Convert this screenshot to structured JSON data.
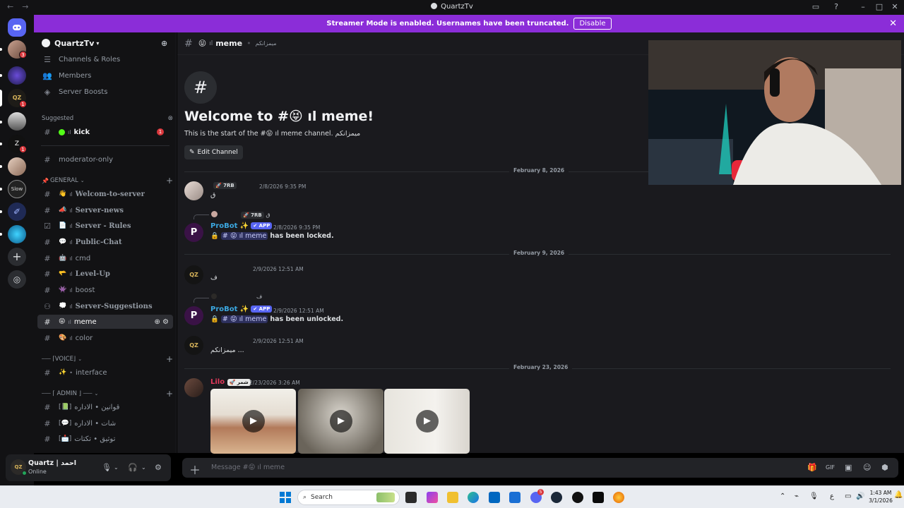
{
  "window": {
    "title": "QuartzTv",
    "back": "←",
    "forward": "→"
  },
  "banner": {
    "text": "Streamer Mode is enabled. Usernames have been truncated.",
    "button": "Disable"
  },
  "rail": {
    "badges": [
      "3",
      "1",
      "1"
    ]
  },
  "server": {
    "name": "QuartzTv"
  },
  "sidebar": {
    "top_items": [
      "Channels & Roles",
      "Members",
      "Server Boosts"
    ],
    "suggested_label": "Suggested",
    "suggested_channel": "kick",
    "suggested_badge": "1",
    "moderator": "moderator-only",
    "general_label": "GENERAL",
    "general_channels": [
      {
        "emoji": "👋",
        "name": "Welcom-to-server"
      },
      {
        "emoji": "📣",
        "name": "Server-news"
      },
      {
        "emoji": "📄",
        "name": "Server - Rules"
      },
      {
        "emoji": "💬",
        "name": "Public-Chat"
      },
      {
        "emoji": "🤖",
        "name": "cmd"
      },
      {
        "emoji": "🫳",
        "name": "Level-Up"
      },
      {
        "emoji": "👾",
        "name": "boost"
      },
      {
        "emoji": "💭",
        "name": "Server-Suggestions"
      },
      {
        "emoji": "😝",
        "name": "meme"
      },
      {
        "emoji": "🎨",
        "name": "color"
      }
    ],
    "voice_label": "⎯⎯⎯ ⌈VOICE⌋",
    "voice_channel": "interface",
    "admin_label": "⎯⎯⎯ ⌈ ADMIN ⌋ ⎯⎯⎯",
    "admin_channels": [
      "قوانين • الاداره",
      "شات • الاداره",
      "توثيق • تكتات"
    ]
  },
  "user": {
    "name": "Quartz | احمد",
    "status": "Online",
    "avatar": "QZ"
  },
  "channel": {
    "name": "meme",
    "emoji": "😝",
    "topic": "ميمزانكم"
  },
  "welcome": {
    "title_prefix": "Welcome to #",
    "title_suffix": " ıl meme!",
    "subtitle": "This is the start of the #😝 ıl meme channel. ميمزانكم",
    "edit_button": "Edit Channel"
  },
  "dates": [
    "February 8, 2026",
    "February 9, 2026",
    "February 23, 2026"
  ],
  "messages": [
    {
      "role": "7RB",
      "time": "2/8/2026 9:35 PM",
      "text": "ق"
    },
    {
      "reply_role": "7RB",
      "reply_text": "ق",
      "author": "ProBot",
      "tag": "APP",
      "time": "2/8/2026 9:35 PM",
      "action": "has been locked."
    },
    {
      "time": "2/9/2026 12:51 AM",
      "text": "ف"
    },
    {
      "reply_text": "ف",
      "author": "ProBot",
      "tag": "APP",
      "time": "2/9/2026 12:51 AM",
      "action": "has been unlocked."
    },
    {
      "time": "2/9/2026 12:51 AM",
      "text": "ميمزانكم ..."
    },
    {
      "author": "Lilo",
      "role": "شمر",
      "time": "2/23/2026 3:26 AM"
    }
  ],
  "composer": {
    "placeholder": "Message #😝 ıl meme"
  },
  "taskbar": {
    "search": "Search",
    "time": "1:43 AM",
    "date": "3/1/2026",
    "lang": "ع",
    "mail_badge": "5"
  },
  "colors": {
    "banner": "#8b2dd8",
    "accent": "#5865f2",
    "probot": "#3ba7e0",
    "lilo": "#e0385a",
    "online": "#23a55a",
    "badge": "#da373c"
  }
}
